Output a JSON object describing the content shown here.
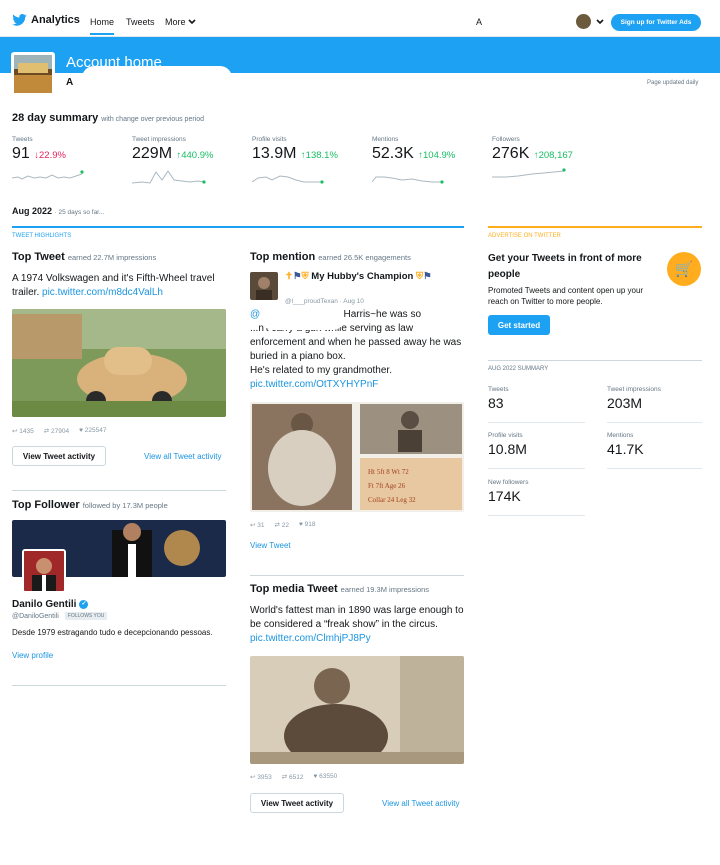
{
  "header": {
    "app_name": "Analytics",
    "nav_home": "Home",
    "nav_tweets": "Tweets",
    "nav_more": "More",
    "search_letter": "A",
    "signup_label": "Sign up for Twitter Ads"
  },
  "account": {
    "title": "Account home",
    "name_initial": "A",
    "page_updated": "Page updated daily"
  },
  "summary": {
    "title": "28 day summary",
    "subtitle": "with change over previous period",
    "stats": [
      {
        "label": "Tweets",
        "value": "91",
        "change": "22.9%",
        "direction": "down"
      },
      {
        "label": "Tweet impressions",
        "value": "229M",
        "change": "440.9%",
        "direction": "up"
      },
      {
        "label": "Profile visits",
        "value": "13.9M",
        "change": "138.1%",
        "direction": "up"
      },
      {
        "label": "Mentions",
        "value": "52.3K",
        "change": "104.9%",
        "direction": "up"
      },
      {
        "label": "Followers",
        "value": "276K",
        "change": "208,167",
        "direction": "up"
      }
    ]
  },
  "month": {
    "label": "Aug 2022",
    "note": "· 25 days so far..."
  },
  "highlights": {
    "section_label": "TWEET HIGHLIGHTS",
    "top_tweet": {
      "title": "Top Tweet",
      "earned": "earned 22.7M impressions",
      "text": "A 1974 Volkswagen and it's Fifth-Wheel travel trailer.",
      "link": "pic.twitter.com/m8dc4ValLh",
      "replies": "1435",
      "retweets": "27904",
      "likes": "225547",
      "view_button": "View Tweet activity",
      "view_all": "View all Tweet activity"
    },
    "top_follower": {
      "title": "Top Follower",
      "followed": "followed by 17.3M people",
      "name": "Danilo Gentili",
      "handle": "@DaniloGentili",
      "follows_you": "FOLLOWS YOU",
      "bio": "Desde 1979 estragando tudo e decepcionando pessoas.",
      "view_profile": "View profile"
    },
    "top_mention": {
      "title": "Top mention",
      "earned": "earned 26.5K engagements",
      "display_name": "My Hubby's Champion",
      "handle": "@l___proudTexan",
      "date": "· Aug 10",
      "line1": "@",
      "line1b": "Sam Harris~he was so",
      "line2": "...n't carry a gun while serving as law enforcement and when he passed away he was buried in a piano box.",
      "line3": "He's related to my grandmother.",
      "link": "pic.twitter.com/OtTXYHYPnF",
      "replies": "31",
      "retweets": "22",
      "likes": "918",
      "view_tweet": "View Tweet"
    },
    "top_media": {
      "title": "Top media Tweet",
      "earned": "earned 19.3M impressions",
      "text": "World's fattest man in 1890 was large enough to be considered a “freak show” in the circus.",
      "link": "pic.twitter.com/ClmhjPJ8Py",
      "replies": "3953",
      "retweets": "6512",
      "likes": "63550",
      "view_button": "View Tweet activity",
      "view_all": "View all Tweet activity"
    }
  },
  "advertise": {
    "section_label": "ADVERTISE ON TWITTER",
    "title": "Get your Tweets in front of more people",
    "body": "Promoted Tweets and content open up your reach on Twitter to more people.",
    "button": "Get started"
  },
  "month_summary": {
    "section_label": "AUG 2022 SUMMARY",
    "items": [
      {
        "label": "Tweets",
        "value": "83"
      },
      {
        "label": "Tweet impressions",
        "value": "203M"
      },
      {
        "label": "Profile visits",
        "value": "10.8M"
      },
      {
        "label": "Mentions",
        "value": "41.7K"
      },
      {
        "label": "New followers",
        "value": "174K"
      }
    ]
  },
  "colors": {
    "accent": "#1da1f2",
    "up": "#17bf63",
    "down": "#e0245e",
    "ads": "#ffad1f"
  }
}
